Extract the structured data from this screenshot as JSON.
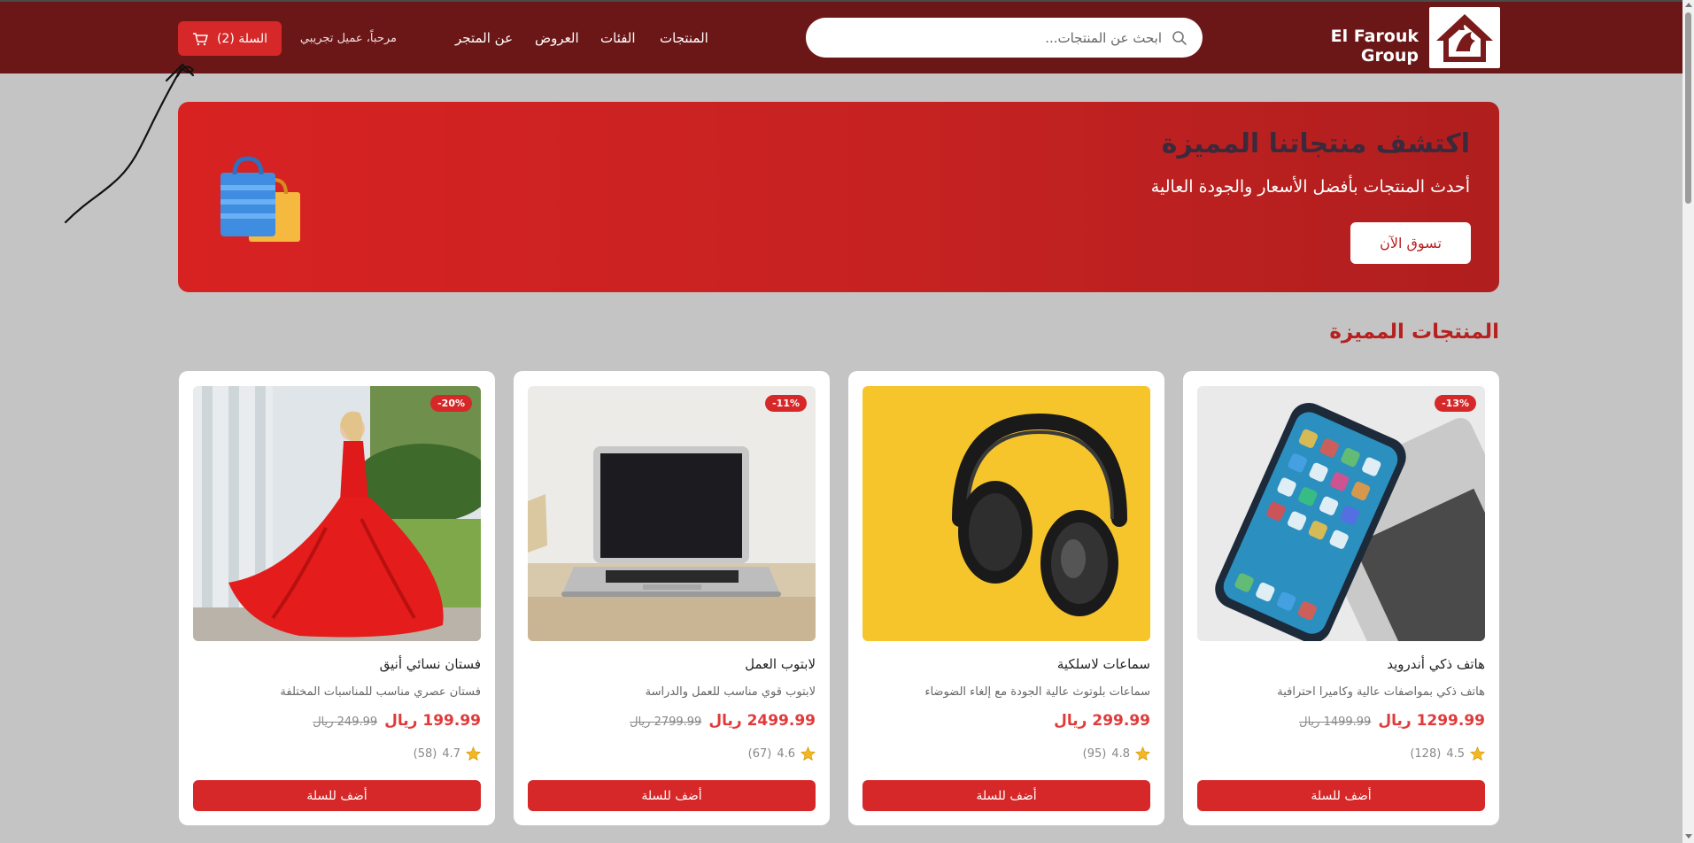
{
  "header": {
    "brand": "El Farouk Group",
    "search_placeholder": "ابحث عن المنتجات...",
    "nav": [
      "المنتجات",
      "الفئات",
      "العروض",
      "عن المتجر"
    ],
    "greeting": "مرحباً، عميل تجريبي",
    "cart_label": "السلة (2)"
  },
  "hero": {
    "title": "اكتشف منتجاتنا المميزة",
    "subtitle": "أحدث المنتجات بأفضل الأسعار والجودة العالية",
    "cta": "تسوق الآن"
  },
  "featured": {
    "title": "المنتجات المميزة",
    "products": [
      {
        "name": "هاتف ذكي أندرويد",
        "description": "هاتف ذكي بمواصفات عالية وكاميرا احترافية",
        "price": "1299.99 ريال",
        "old_price": "1499.99 ريال",
        "discount": "-13%",
        "rating": "4.5",
        "reviews": "(128)",
        "button": "أضف للسلة"
      },
      {
        "name": "سماعات لاسلكية",
        "description": "سماعات بلوتوث عالية الجودة مع إلغاء الضوضاء",
        "price": "299.99 ريال",
        "old_price": "",
        "discount": "",
        "rating": "4.8",
        "reviews": "(95)",
        "button": "أضف للسلة"
      },
      {
        "name": "لابتوب العمل",
        "description": "لابتوب قوي مناسب للعمل والدراسة",
        "price": "2499.99 ريال",
        "old_price": "2799.99 ريال",
        "discount": "-11%",
        "rating": "4.6",
        "reviews": "(67)",
        "button": "أضف للسلة"
      },
      {
        "name": "فستان نسائي أنيق",
        "description": "فستان عصري مناسب للمناسبات المختلفة",
        "price": "199.99 ريال",
        "old_price": "249.99 ريال",
        "discount": "-20%",
        "rating": "4.7",
        "reviews": "(58)",
        "button": "أضف للسلة"
      }
    ]
  },
  "colors": {
    "header_bg": "#6b1717",
    "accent": "#d62828",
    "price": "#e03a3a",
    "page_bg": "#c4c4c4"
  },
  "icons": [
    "logo-house-icon",
    "search-icon",
    "cart-icon",
    "shopping-bag-icon",
    "star-icon"
  ]
}
